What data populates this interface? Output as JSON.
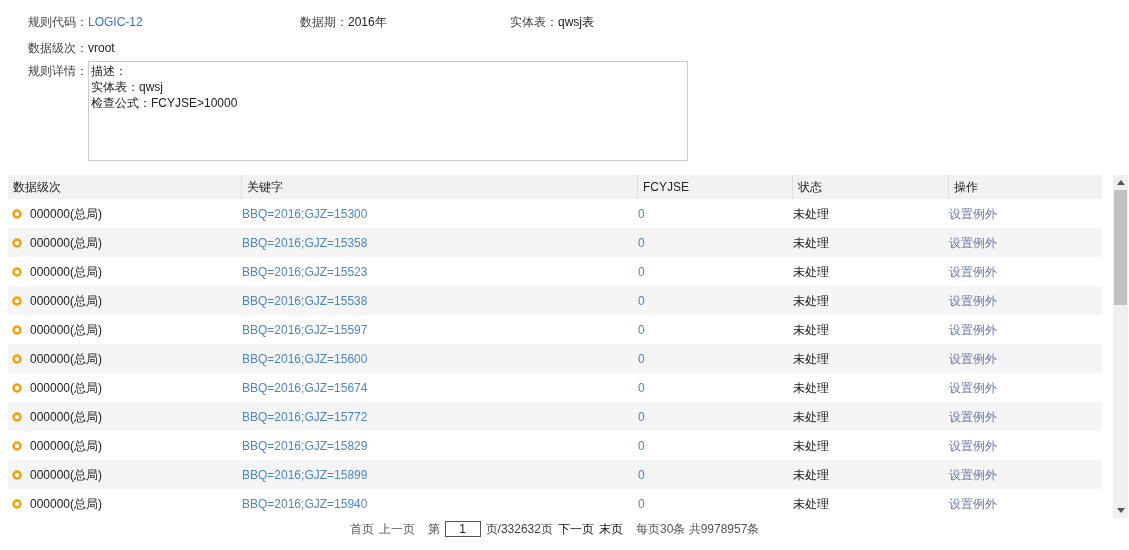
{
  "info": {
    "rule_code": {
      "label": "规则代码：",
      "value": "LOGIC-12"
    },
    "period": {
      "label": "数据期：",
      "value": "2016年"
    },
    "entity": {
      "label": "实体表：",
      "value": "qwsj表"
    },
    "level": {
      "label": "数据级次：",
      "value": "vroot"
    },
    "details": {
      "label": "规则详情：",
      "lines": [
        "描述：",
        "实体表：qwsj",
        "检查公式：FCYJSE>10000"
      ]
    }
  },
  "table": {
    "columns": [
      "数据级次",
      "关键字",
      "FCYJSE",
      "状态",
      "操作"
    ],
    "rows": [
      {
        "level": "000000(总局)",
        "key": "BBQ=2016;GJZ=15300",
        "value": "0",
        "status": "未处理",
        "action": "设置例外"
      },
      {
        "level": "000000(总局)",
        "key": "BBQ=2016;GJZ=15358",
        "value": "0",
        "status": "未处理",
        "action": "设置例外"
      },
      {
        "level": "000000(总局)",
        "key": "BBQ=2016;GJZ=15523",
        "value": "0",
        "status": "未处理",
        "action": "设置例外"
      },
      {
        "level": "000000(总局)",
        "key": "BBQ=2016;GJZ=15538",
        "value": "0",
        "status": "未处理",
        "action": "设置例外"
      },
      {
        "level": "000000(总局)",
        "key": "BBQ=2016;GJZ=15597",
        "value": "0",
        "status": "未处理",
        "action": "设置例外"
      },
      {
        "level": "000000(总局)",
        "key": "BBQ=2016;GJZ=15600",
        "value": "0",
        "status": "未处理",
        "action": "设置例外"
      },
      {
        "level": "000000(总局)",
        "key": "BBQ=2016;GJZ=15674",
        "value": "0",
        "status": "未处理",
        "action": "设置例外"
      },
      {
        "level": "000000(总局)",
        "key": "BBQ=2016;GJZ=15772",
        "value": "0",
        "status": "未处理",
        "action": "设置例外"
      },
      {
        "level": "000000(总局)",
        "key": "BBQ=2016;GJZ=15829",
        "value": "0",
        "status": "未处理",
        "action": "设置例外"
      },
      {
        "level": "000000(总局)",
        "key": "BBQ=2016;GJZ=15899",
        "value": "0",
        "status": "未处理",
        "action": "设置例外"
      },
      {
        "level": "000000(总局)",
        "key": "BBQ=2016;GJZ=15940",
        "value": "0",
        "status": "未处理",
        "action": "设置例外"
      }
    ]
  },
  "pager": {
    "first": {
      "label": "首页",
      "disabled": true
    },
    "prev": {
      "label": "上一页",
      "disabled": true
    },
    "page_prefix": "第",
    "page": "1",
    "page_suffix": "页/332632页",
    "next": {
      "label": "下一页",
      "disabled": false
    },
    "last": {
      "label": "末页",
      "disabled": false
    },
    "summary": "每页30条 共9978957条"
  }
}
